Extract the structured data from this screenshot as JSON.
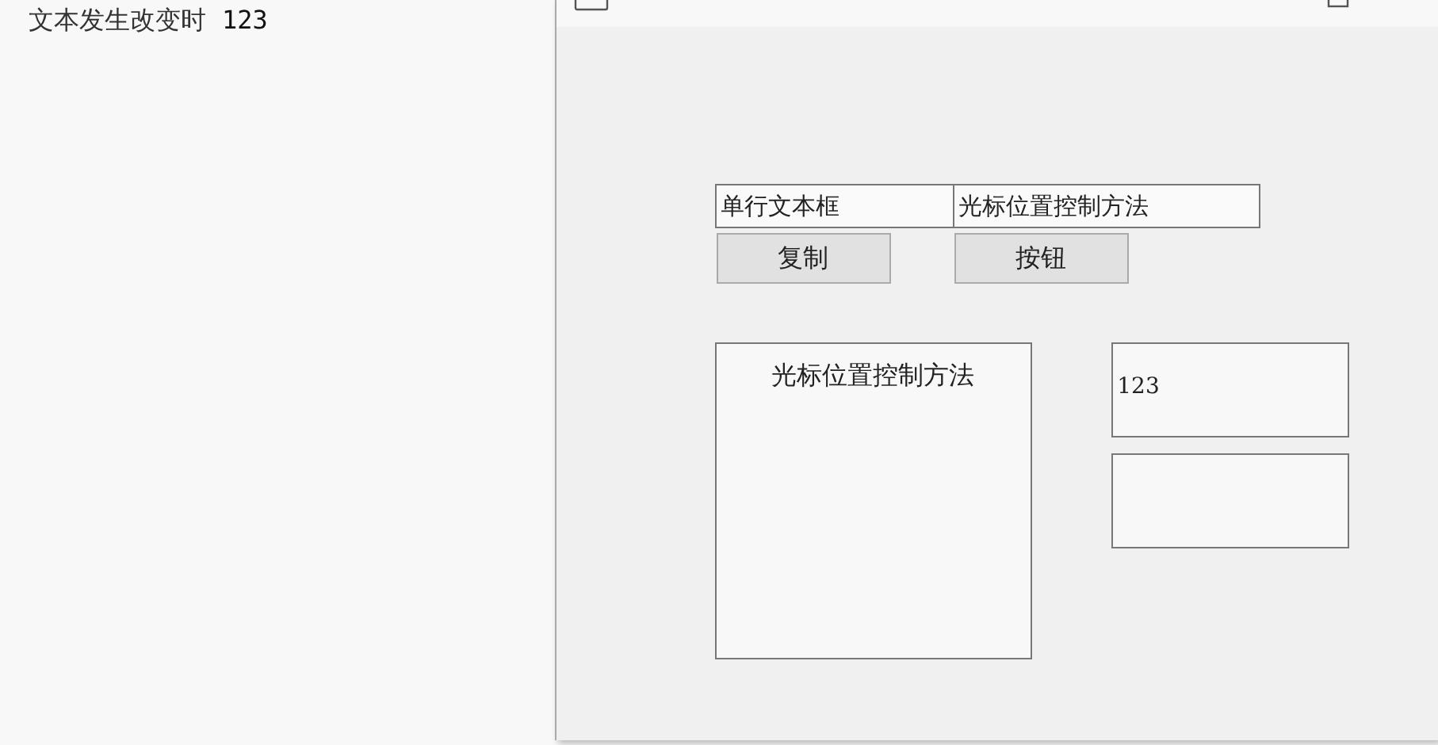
{
  "console": {
    "label": "文本发生改变时",
    "value": "123"
  },
  "window": {
    "fields": [
      {
        "value": "单行文本框"
      },
      {
        "value": "光标位置控制方法"
      }
    ],
    "buttons": [
      "复制",
      "按钮"
    ],
    "text_area": {
      "value": "光标位置控制方法"
    },
    "output_box": {
      "value": "123"
    }
  }
}
